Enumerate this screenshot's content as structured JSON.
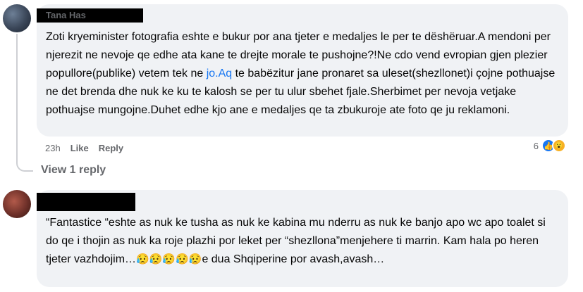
{
  "comments": [
    {
      "author": "Tana Has",
      "text_before_link": "Zoti kryeminister fotografia eshte e bukur por ana tjeter e medaljes le per te dëshëruar.A mendoni per njerezit ne nevoje qe edhe ata kane te drejte morale te pushojne?!Ne cdo vend evropian gjen plezier popullore(publike) vetem tek ne ",
      "link": "jo.Aq",
      "text_after_link": " te babëzitur jane pronaret sa uleset(shezllonet)i çojne pothuajse ne det brenda dhe nuk ke ku te kalosh se per tu ulur sbehet fjale.Sherbimet per nevoja vetjake pothuajse mungojne.Duhet edhe kjo ane e medaljes qe ta zbukuroje ate foto qe ju reklamoni.",
      "time": "23h",
      "like_label": "Like",
      "reply_label": "Reply",
      "reaction_count": "6",
      "reactions": [
        "like-icon",
        "wow-icon"
      ]
    },
    {
      "author": "",
      "text": "“Fantastice “eshte as nuk ke tusha as nuk ke kabina mu nderru as nuk ke banjo apo wc apo toalet si do qe i thojin as nuk ka roje plazhi por leket per “shezllona”menjehere ti marrin. Kam hala po heren tjeter vazhdojim…",
      "emojis": "😥😥😥😥😥",
      "text_end": "e dua Shqiperine por avash,avash…"
    }
  ],
  "view_replies_label": "View 1 reply",
  "colors": {
    "bubble": "#f0f2f5",
    "secondary_text": "#65676b",
    "link": "#1877f2",
    "like": "#1877f2",
    "wow": "#f7b125"
  }
}
